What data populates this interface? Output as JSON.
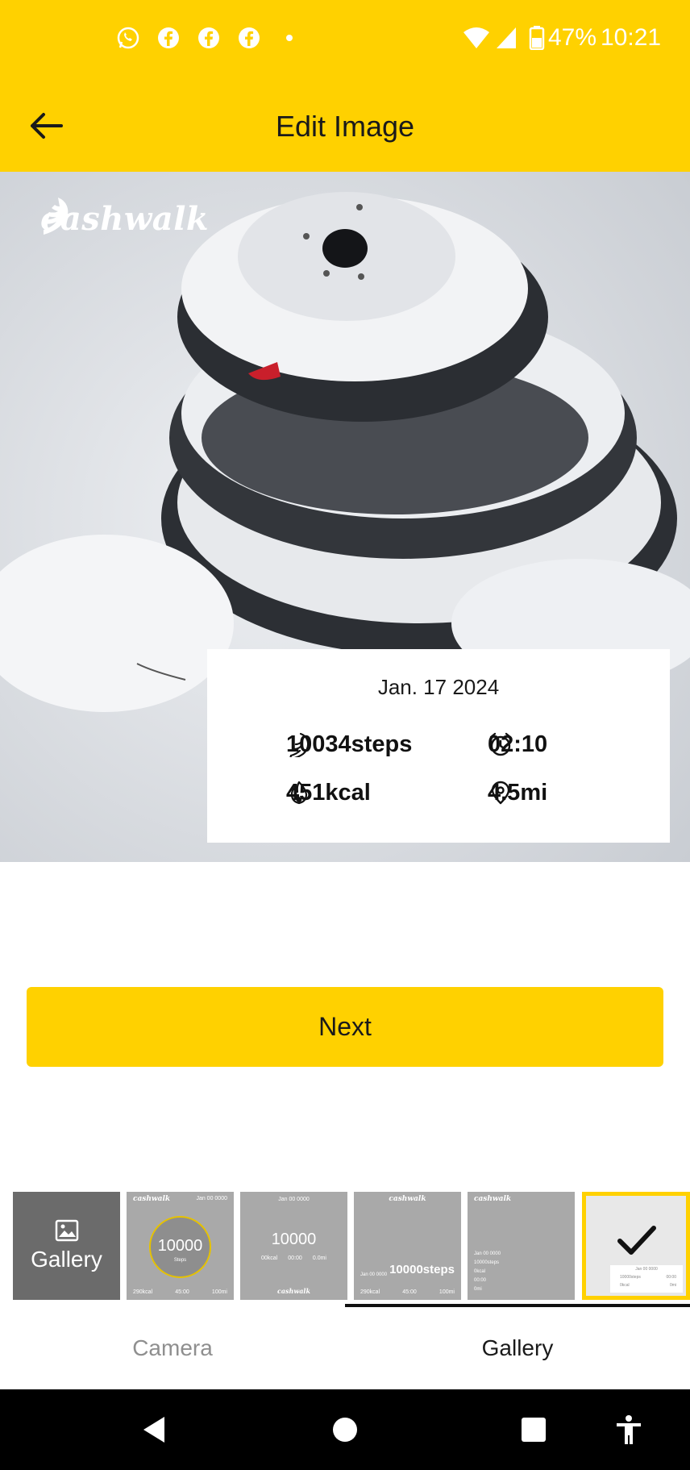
{
  "status_bar": {
    "notification_icons": [
      "whatsapp-icon",
      "facebook-icon",
      "facebook-icon",
      "facebook-icon",
      "dot-icon"
    ],
    "battery": "47%",
    "time": "10:21"
  },
  "header": {
    "back_icon": "arrow-left-icon",
    "title": "Edit Image"
  },
  "photo": {
    "brand": "cashwalk",
    "stats": {
      "date": "Jan. 17 2024",
      "steps": "10034steps",
      "time": "02:10",
      "kcal": "451kcal",
      "distance": "4.5mi"
    }
  },
  "next_button": {
    "label": "Next"
  },
  "thumbnails": {
    "gallery_label": "Gallery",
    "templates": [
      {
        "brand": "cashwalk",
        "date": "Jan 00 0000",
        "big": "10000",
        "sub": "Steps",
        "kcal": "290kcal",
        "time": "45:00",
        "dist": "100mi"
      },
      {
        "date": "Jan 00 0000",
        "big": "10000",
        "kcal": "00kcal",
        "time": "00:00",
        "dist": "0.0mi",
        "brand": "cashwalk"
      },
      {
        "brand": "cashwalk",
        "date": "Jan 00 0000",
        "big": "10000steps",
        "kcal": "290kcal",
        "time": "45:00",
        "dist": "100mi"
      },
      {
        "brand": "cashwalk",
        "list": [
          "Jan 00 0000",
          "10000steps",
          "0kcal",
          "00:00",
          "0mi"
        ]
      }
    ],
    "selected": {
      "check_icon": "checkmark-icon",
      "card": {
        "date": "Jan 00 0000",
        "steps": "10000steps",
        "time": "00:00",
        "kcal": "0kcal",
        "dist": "0mi"
      }
    }
  },
  "tabs": [
    {
      "label": "Camera",
      "active": false
    },
    {
      "label": "Gallery",
      "active": true
    }
  ],
  "nav_bar": {
    "buttons": [
      "back-triangle-icon",
      "home-circle-icon",
      "recents-square-icon",
      "accessibility-icon"
    ]
  },
  "colors": {
    "accent": "#FFD100",
    "text": "#1a1a1a",
    "inactive_tab": "#8f8f8f"
  }
}
